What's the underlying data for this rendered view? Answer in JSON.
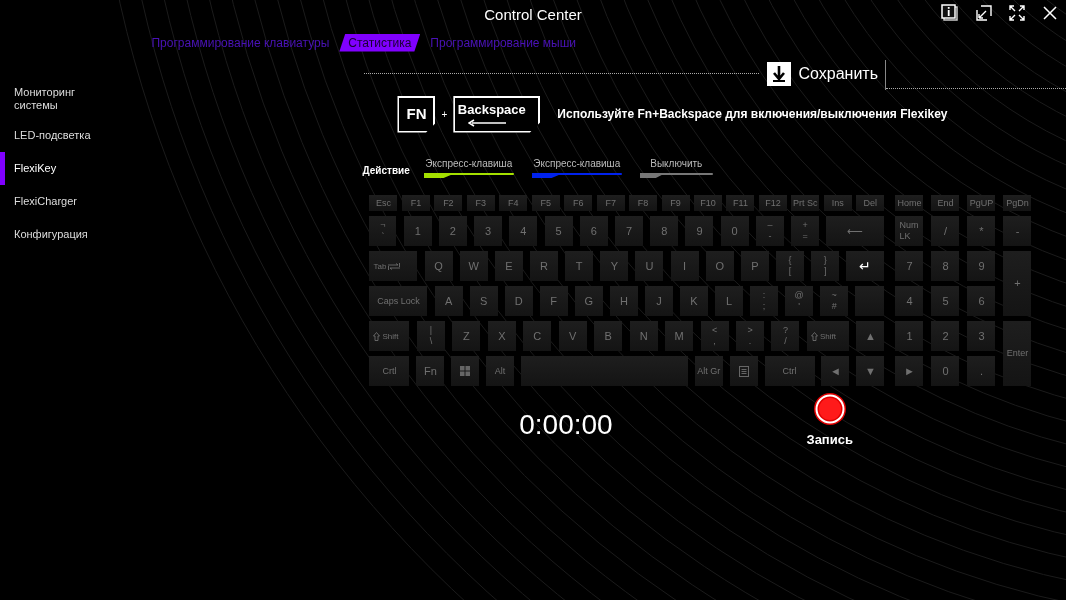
{
  "window": {
    "title": "Control Center"
  },
  "sidebar": {
    "items": [
      {
        "label": "Мониторинг системы",
        "selected": false
      },
      {
        "label": "LED-подсветка",
        "selected": false
      },
      {
        "label": "FlexiKey",
        "selected": true
      },
      {
        "label": "FlexiCharger",
        "selected": false
      },
      {
        "label": "Конфигурация",
        "selected": false
      }
    ]
  },
  "tabs": [
    {
      "label": "Программирование клавиатуры",
      "selected": false
    },
    {
      "label": "Статистика",
      "selected": true
    },
    {
      "label": "Программирование мыши",
      "selected": false
    }
  ],
  "save_button": {
    "label": "Сохранить"
  },
  "hint": {
    "fn_key": "FN",
    "plus": "+",
    "backspace_key": "Backspace",
    "text": "Используйте Fn+Backspace для включения/выключения Flexikey"
  },
  "legend": {
    "label": "Действие",
    "items": [
      {
        "label": "Экспресс-клавиша",
        "color": "#a4e000"
      },
      {
        "label": "Экспресс-клавиша",
        "color": "#0022ee"
      },
      {
        "label": "Выключить",
        "color": "#777777"
      }
    ]
  },
  "keyboard": {
    "main_rows": [
      [
        {
          "label": "Esc"
        },
        {
          "label": "F1"
        },
        {
          "label": "F2"
        },
        {
          "label": "F3"
        },
        {
          "label": "F4"
        },
        {
          "label": "F5"
        },
        {
          "label": "F6"
        },
        {
          "label": "F7"
        },
        {
          "label": "F8"
        },
        {
          "label": "F9"
        },
        {
          "label": "F10"
        },
        {
          "label": "F11"
        },
        {
          "label": "F12"
        },
        {
          "label": "Prt Sc"
        },
        {
          "label": "Ins"
        },
        {
          "label": "Del"
        }
      ],
      [
        {
          "label": "`",
          "upper": "¬"
        },
        {
          "label": "1"
        },
        {
          "label": "2"
        },
        {
          "label": "3"
        },
        {
          "label": "4"
        },
        {
          "label": "5"
        },
        {
          "label": "6"
        },
        {
          "label": "7"
        },
        {
          "label": "8"
        },
        {
          "label": "9"
        },
        {
          "label": "0"
        },
        {
          "label": "-",
          "upper": "–"
        },
        {
          "label": "=",
          "upper": "+"
        },
        {
          "label": "⟵"
        }
      ],
      [
        {
          "label": "Tab",
          "kind": "tab"
        },
        {
          "label": "Q"
        },
        {
          "label": "W"
        },
        {
          "label": "E"
        },
        {
          "label": "R"
        },
        {
          "label": "T"
        },
        {
          "label": "Y"
        },
        {
          "label": "U"
        },
        {
          "label": "I"
        },
        {
          "label": "O"
        },
        {
          "label": "P"
        },
        {
          "label": "[",
          "upper": "{"
        },
        {
          "label": "]",
          "upper": "}"
        },
        {
          "label": "↵",
          "kind": "enter"
        }
      ],
      [
        {
          "label": "Caps Lock"
        },
        {
          "label": "A"
        },
        {
          "label": "S"
        },
        {
          "label": "D"
        },
        {
          "label": "F"
        },
        {
          "label": "G"
        },
        {
          "label": "H"
        },
        {
          "label": "J"
        },
        {
          "label": "K"
        },
        {
          "label": "L"
        },
        {
          "label": ";",
          "upper": ":"
        },
        {
          "label": "'",
          "upper": "@"
        },
        {
          "label": "#",
          "upper": "~"
        },
        {
          "kind": "blank"
        }
      ],
      [
        {
          "label": "Shift",
          "kind": "shift"
        },
        {
          "label": "\\",
          "upper": "|"
        },
        {
          "label": "Z"
        },
        {
          "label": "X"
        },
        {
          "label": "C"
        },
        {
          "label": "V"
        },
        {
          "label": "B"
        },
        {
          "label": "N"
        },
        {
          "label": "M"
        },
        {
          "label": ",",
          "upper": "<"
        },
        {
          "label": ".",
          "upper": ">"
        },
        {
          "label": "/",
          "upper": "?"
        },
        {
          "label": "Shift",
          "kind": "shift"
        },
        {
          "label": "▲"
        }
      ],
      [
        {
          "label": "Crtl"
        },
        {
          "label": "Fn"
        },
        {
          "kind": "win"
        },
        {
          "label": "Alt"
        },
        {
          "kind": "blank"
        },
        {
          "label": "Alt Gr"
        },
        {
          "kind": "menu"
        },
        {
          "label": "Ctrl"
        },
        {
          "label": "◄"
        },
        {
          "label": "▼"
        }
      ]
    ],
    "numpad": [
      {
        "label": "Home"
      },
      {
        "label": "End"
      },
      {
        "label": "PgUP"
      },
      {
        "label": "PgDn"
      },
      {
        "label": "Num LK"
      },
      {
        "label": "/"
      },
      {
        "label": "*"
      },
      {
        "label": "-"
      },
      {
        "label": "7"
      },
      {
        "label": "8"
      },
      {
        "label": "9"
      },
      {
        "label": "+",
        "kind": "tall"
      },
      {
        "label": "4"
      },
      {
        "label": "5"
      },
      {
        "label": "6"
      },
      {
        "label": "1"
      },
      {
        "label": "2"
      },
      {
        "label": "3"
      },
      {
        "label": "Enter",
        "kind": "tall"
      },
      {
        "label": "►"
      },
      {
        "label": "0"
      },
      {
        "label": "."
      }
    ]
  },
  "timer": "0:00:00",
  "record_button": {
    "label": "Запись"
  }
}
